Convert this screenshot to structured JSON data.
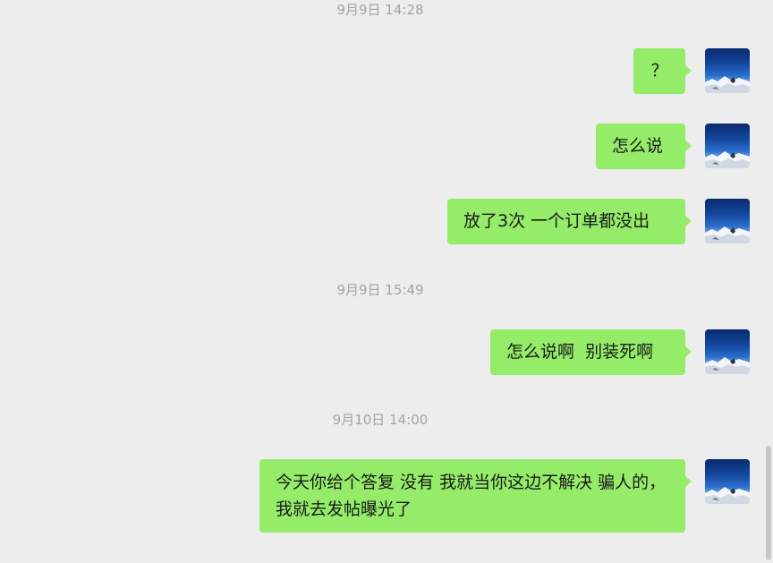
{
  "chat": {
    "timestamps": [
      "9月9日 14:28",
      "9月9日 15:49",
      "9月10日 14:00"
    ],
    "messages": [
      {
        "sender": "self",
        "text": "？"
      },
      {
        "sender": "self",
        "text": "怎么说"
      },
      {
        "sender": "self",
        "text": "放了3次 一个订单都没出"
      },
      {
        "sender": "self",
        "text": "怎么说啊  别装死啊"
      },
      {
        "sender": "self",
        "text": "今天你给个答复 没有 我就当你这边不解决 骗人的，我就去发帖曝光了"
      }
    ],
    "bubble_color": "#95ec69",
    "background_color": "#ededed",
    "avatar_icon": "mountain-sky-avatar"
  }
}
